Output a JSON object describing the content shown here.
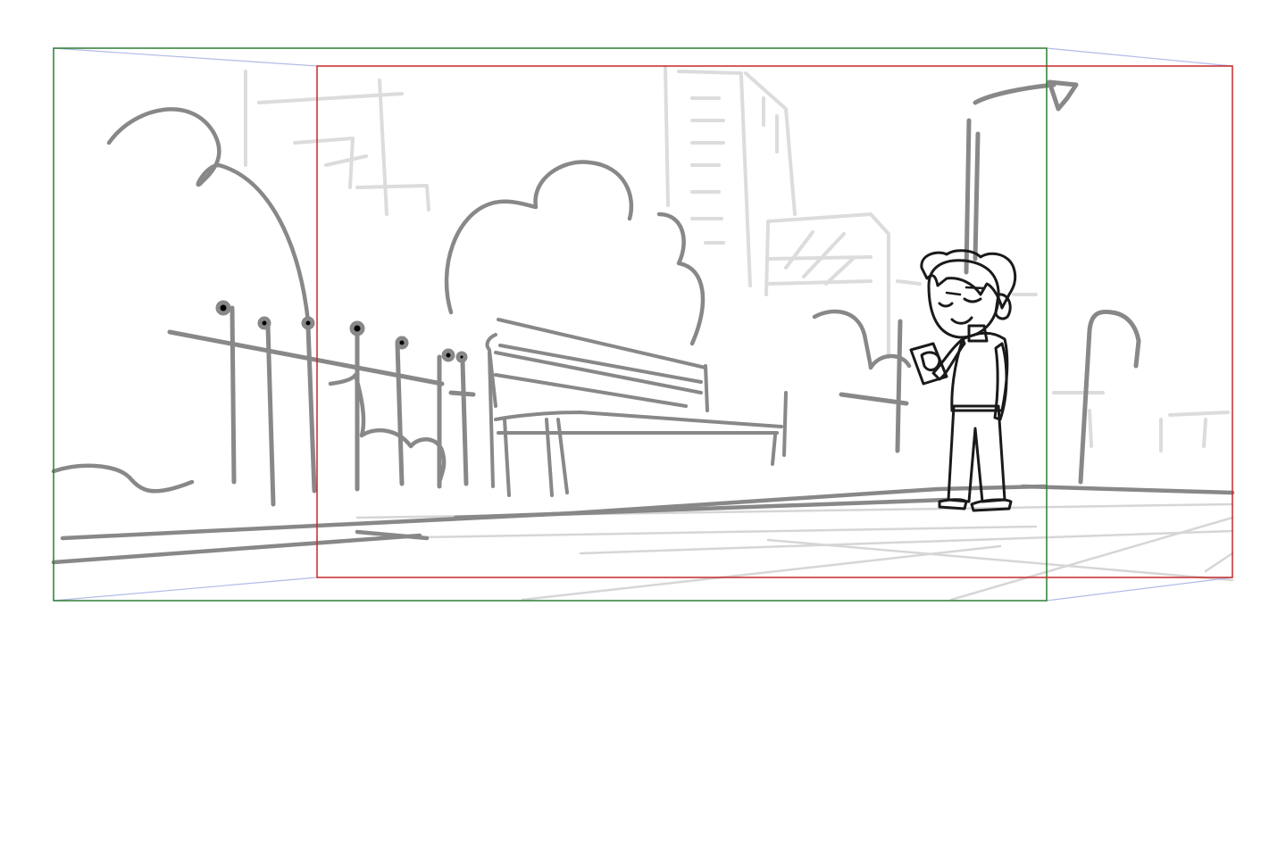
{
  "canvas": {
    "background": "#ffffff"
  },
  "colors": {
    "sketch_stroke": "#888888",
    "background_stroke": "#d9d9d9",
    "camera_start_frame": "#2e7d32",
    "camera_end_frame": "#c62828",
    "camera_guide": "#a9b4e0",
    "character_fill": "#999999",
    "character_outline": "#1a1a1a",
    "character_skin": "#ffffff"
  },
  "frames": {
    "start_frame": {
      "label": "",
      "color": "#2e7d32"
    },
    "end_frame": {
      "label": "",
      "color": "#c62828"
    }
  },
  "scene": {
    "elements": [
      "trees",
      "buildings",
      "street-lamp",
      "bench",
      "fence-posts",
      "character-with-phone",
      "pavement"
    ]
  }
}
